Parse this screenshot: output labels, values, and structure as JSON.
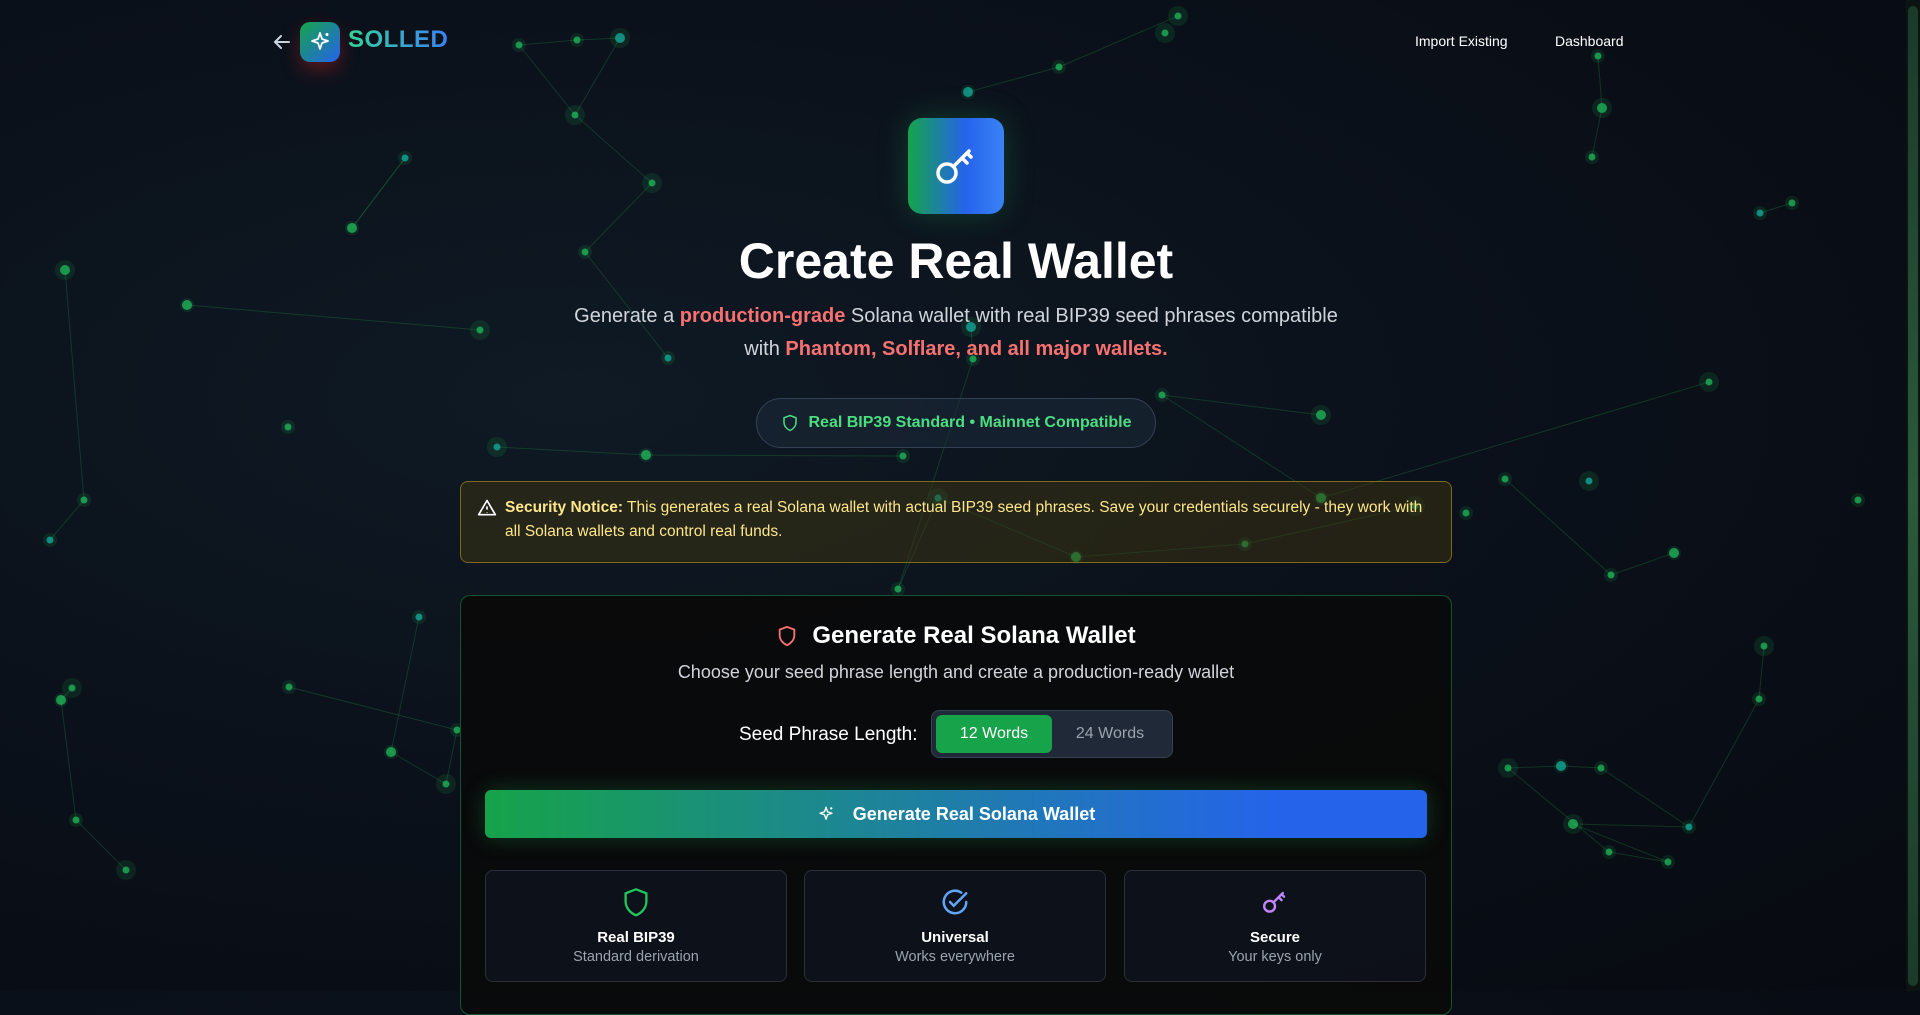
{
  "header": {
    "brand": "SOLLED",
    "nav_links": [
      "Import Existing",
      "Dashboard"
    ]
  },
  "hero": {
    "title": "Create Real Wallet",
    "subtitle_parts": {
      "p1": "Generate a ",
      "p2": "production-grade",
      "p3": " Solana wallet with real BIP39 seed phrases compatible with ",
      "p4": "Phantom, Solflare, and all major wallets."
    },
    "badge": "Real BIP39 Standard • Mainnet Compatible"
  },
  "notice": {
    "label": "Security Notice:",
    "text": "This generates a real Solana wallet with actual BIP39 seed phrases. Save your credentials securely - they work with all Solana wallets and control real funds."
  },
  "card": {
    "title": "Generate Real Solana Wallet",
    "subtitle": "Choose your seed phrase length and create a production-ready wallet",
    "seed_label": "Seed Phrase Length:",
    "options": [
      "12 Words",
      "24 Words"
    ],
    "selected": "12 Words",
    "generate_button": "Generate Real Solana Wallet",
    "features": [
      {
        "title": "Real BIP39",
        "desc": "Standard derivation",
        "icon": "shield-icon",
        "color": "#22c55e"
      },
      {
        "title": "Universal",
        "desc": "Works everywhere",
        "icon": "check-circle-icon",
        "color": "#60a5fa"
      },
      {
        "title": "Secure",
        "desc": "Your keys only",
        "icon": "key-icon",
        "color": "#c084fc"
      }
    ]
  },
  "colors": {
    "accent_green": "#16a34a",
    "accent_blue": "#2563eb",
    "highlight_red": "#f87171",
    "badge_green": "#4ade80",
    "notice_yellow": "#fde68a"
  }
}
